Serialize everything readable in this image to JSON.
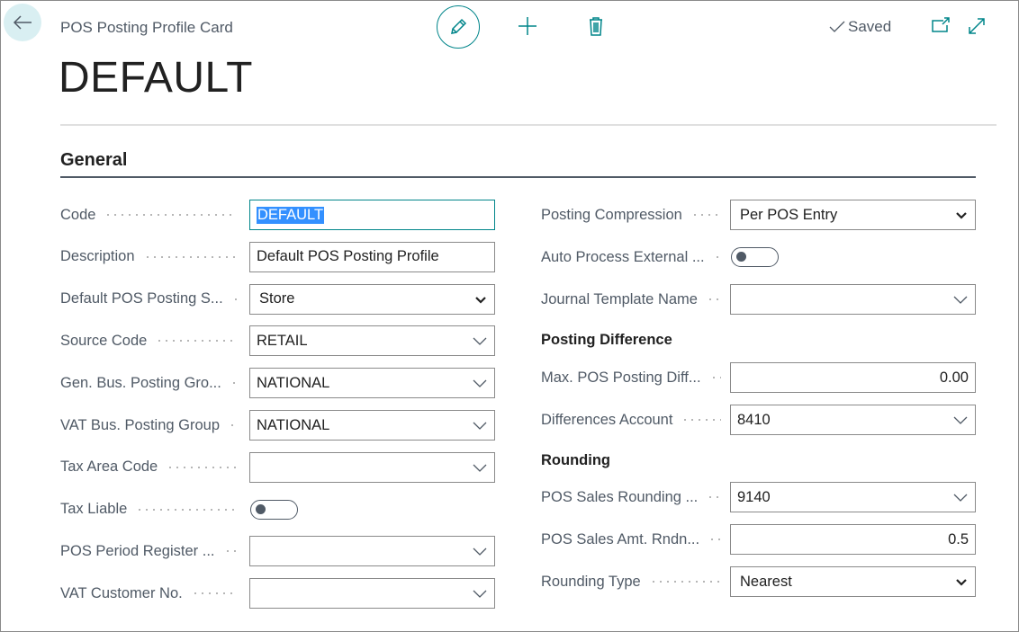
{
  "header": {
    "breadcrumb": "POS Posting Profile Card",
    "title": "DEFAULT",
    "status": "Saved"
  },
  "colors": {
    "accent": "#00858a",
    "selection": "#3390ff"
  },
  "section": {
    "title": "General"
  },
  "left": [
    {
      "label": "Code",
      "value": "DEFAULT",
      "type": "text"
    },
    {
      "label": "Description",
      "value": "Default POS Posting Profile",
      "type": "text"
    },
    {
      "label": "Default POS Posting S...",
      "value": "Store",
      "type": "select"
    },
    {
      "label": "Source Code",
      "value": "RETAIL",
      "type": "lookup"
    },
    {
      "label": "Gen. Bus. Posting Gro...",
      "value": "NATIONAL",
      "type": "lookup"
    },
    {
      "label": "VAT Bus. Posting Group",
      "value": "NATIONAL",
      "type": "lookup"
    },
    {
      "label": "Tax Area Code",
      "value": "",
      "type": "lookup"
    },
    {
      "label": "Tax Liable",
      "value": false,
      "type": "toggle"
    },
    {
      "label": "POS Period Register ...",
      "value": "",
      "type": "lookup"
    },
    {
      "label": "VAT Customer No.",
      "value": "",
      "type": "lookup"
    }
  ],
  "right": {
    "fields": [
      {
        "label": "Posting Compression",
        "value": "Per POS Entry",
        "type": "select"
      },
      {
        "label": "Auto Process External ...",
        "value": false,
        "type": "toggle"
      },
      {
        "label": "Journal Template Name",
        "value": "",
        "type": "lookup"
      }
    ],
    "posting_difference": {
      "title": "Posting Difference",
      "fields": [
        {
          "label": "Max. POS Posting Diff...",
          "value": "0.00",
          "type": "number"
        },
        {
          "label": "Differences Account",
          "value": "8410",
          "type": "lookup"
        }
      ]
    },
    "rounding": {
      "title": "Rounding",
      "fields": [
        {
          "label": "POS Sales Rounding ...",
          "value": "9140",
          "type": "lookup"
        },
        {
          "label": "POS Sales Amt. Rndn...",
          "value": "0.5",
          "type": "number"
        },
        {
          "label": "Rounding Type",
          "value": "Nearest",
          "type": "select"
        }
      ]
    }
  }
}
